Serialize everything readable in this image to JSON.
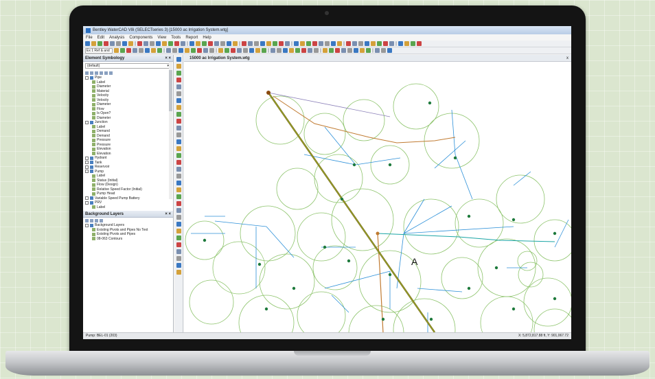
{
  "window": {
    "title": "Bentley WaterCAD V8i (SELECTseries 3) [15000 ac Irrigation System.wtg]"
  },
  "menu": [
    "File",
    "Edit",
    "Analysis",
    "Components",
    "View",
    "Tools",
    "Report",
    "Help"
  ],
  "toolbar": {
    "scenario_select": "Ex 1 Ref & and"
  },
  "element_symbology": {
    "title": "Element Symbology",
    "dropdown_value": "(default)",
    "tree": [
      {
        "label": "Pipe",
        "level": 0,
        "checked": true
      },
      {
        "label": "Label",
        "level": 1
      },
      {
        "label": "Diameter",
        "level": 1
      },
      {
        "label": "Material",
        "level": 1
      },
      {
        "label": "Velocity",
        "level": 1
      },
      {
        "label": "Velocity",
        "level": 1
      },
      {
        "label": "Diameter",
        "level": 1
      },
      {
        "label": "Flow",
        "level": 1
      },
      {
        "label": "Is Open?",
        "level": 1
      },
      {
        "label": "Diameter",
        "level": 1
      },
      {
        "label": "Junction",
        "level": 0,
        "checked": true
      },
      {
        "label": "Label",
        "level": 1
      },
      {
        "label": "Demand",
        "level": 1
      },
      {
        "label": "Demand",
        "level": 1
      },
      {
        "label": "Pressure",
        "level": 1
      },
      {
        "label": "Pressure",
        "level": 1
      },
      {
        "label": "Elevation",
        "level": 1
      },
      {
        "label": "Elevation",
        "level": 1
      },
      {
        "label": "Hydrant",
        "level": 0,
        "checked": true
      },
      {
        "label": "Tank",
        "level": 0,
        "checked": true
      },
      {
        "label": "Reservoir",
        "level": 0,
        "checked": true
      },
      {
        "label": "Pump",
        "level": 0,
        "checked": true
      },
      {
        "label": "Label",
        "level": 1
      },
      {
        "label": "Status (Initial)",
        "level": 1
      },
      {
        "label": "Flow (Design)",
        "level": 1
      },
      {
        "label": "Relative Speed Factor (Initial)",
        "level": 1
      },
      {
        "label": "Pump Head",
        "level": 1
      },
      {
        "label": "Variable Speed Pump Battery",
        "level": 0,
        "checked": true
      },
      {
        "label": "PRV",
        "level": 0,
        "checked": true
      },
      {
        "label": "Label",
        "level": 1
      }
    ]
  },
  "background_layers": {
    "title": "Background Layers",
    "items": [
      {
        "label": "Background Layers",
        "level": 0
      },
      {
        "label": "Existing Pivots and Pipes No Text",
        "level": 1
      },
      {
        "label": "Existing Pivots and Pipes",
        "level": 1
      },
      {
        "label": "08-063 Contours",
        "level": 1
      }
    ]
  },
  "drawing": {
    "tab_title": "15000 ac Irrigation System.wtg",
    "close_label": "x",
    "annotation": "A"
  },
  "status": {
    "left": "Pump: BEL-01 (203)",
    "right": "X: 5,872,817.88 ft, Y: 901,067.72"
  },
  "colors": {
    "accent": "#2a6fc0",
    "circle": "#8cc36a",
    "pipe_main": "#7a6a1a",
    "pipe_blue": "#2b8fd8",
    "junction": "#1e7a3c"
  }
}
